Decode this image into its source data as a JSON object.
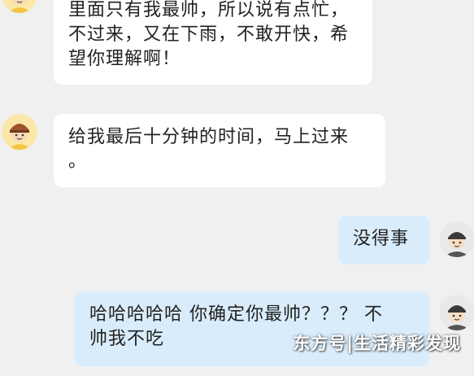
{
  "messages": [
    {
      "sender": "courier",
      "text": "里面只有我最帅，所以说有点忙，\n不过来，又在下雨，不敢开快，希\n望你理解啊！"
    },
    {
      "sender": "courier",
      "text": "给我最后十分钟的时间，马上过来\n。"
    },
    {
      "sender": "me",
      "text": "没得事"
    },
    {
      "sender": "me",
      "text": "哈哈哈哈哈 你确定你最帅？？？ 不\n帅我不吃"
    }
  ],
  "watermark": "东方号|生活精彩发现",
  "colors": {
    "background": "#f0f0f0",
    "incoming_bubble": "#ffffff",
    "outgoing_bubble": "#d9ecfb",
    "courier_avatar_bg": "#f5c542"
  },
  "icons": {
    "courier_avatar": "courier-helmet-avatar-icon",
    "user_avatar": "user-cap-avatar-icon"
  }
}
